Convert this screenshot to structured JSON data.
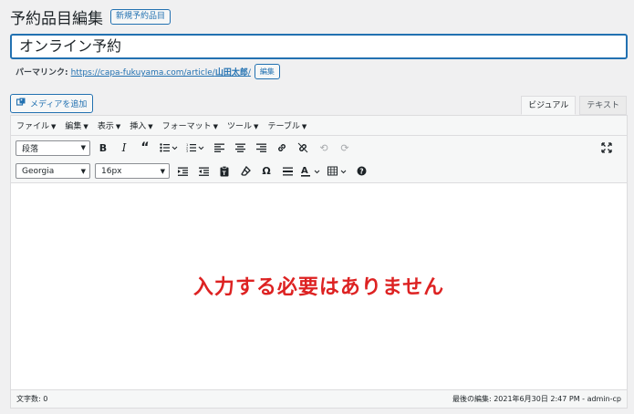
{
  "header": {
    "title": "予約品目編集",
    "add_new_label": "新規予約品目"
  },
  "title_field": {
    "value": "オンライン予約"
  },
  "permalink": {
    "label": "パーマリンク:",
    "url_prefix": "https://capa-fukuyama.com/article/",
    "slug": "山田太郎",
    "url_suffix": "/",
    "edit_label": "編集"
  },
  "media_button": {
    "label": "メディアを追加",
    "icon": "media-icon"
  },
  "tabs": [
    {
      "label": "ビジュアル",
      "active": true
    },
    {
      "label": "テキスト",
      "active": false
    }
  ],
  "menubar": {
    "items": [
      {
        "label": "ファイル"
      },
      {
        "label": "編集"
      },
      {
        "label": "表示"
      },
      {
        "label": "挿入"
      },
      {
        "label": "フォーマット"
      },
      {
        "label": "ツール"
      },
      {
        "label": "テーブル"
      }
    ]
  },
  "toolbar1": {
    "format_select": "段落",
    "buttons": [
      "bold-icon",
      "italic-icon",
      "blockquote-icon",
      "bullet-list-icon",
      "numbered-list-icon",
      "align-left-icon",
      "align-center-icon",
      "align-right-icon",
      "link-icon",
      "unlink-icon",
      "undo-icon",
      "redo-icon",
      "fullscreen-icon"
    ]
  },
  "toolbar2": {
    "font_select": "Georgia",
    "size_select": "16px",
    "buttons": [
      "indent-icon",
      "outdent-icon",
      "paste-text-icon",
      "clear-format-icon",
      "omega-icon",
      "horizontal-line-icon",
      "text-color-icon",
      "table-icon",
      "help-icon"
    ]
  },
  "content": {
    "text": "入力する必要はありません"
  },
  "statusbar": {
    "word_count": "文字数: 0",
    "last_edited": "最後の編集: 2021年6月30日 2:47 PM - admin-cp"
  },
  "colors": {
    "accent": "#2271b1",
    "content_text": "#dd2222"
  }
}
